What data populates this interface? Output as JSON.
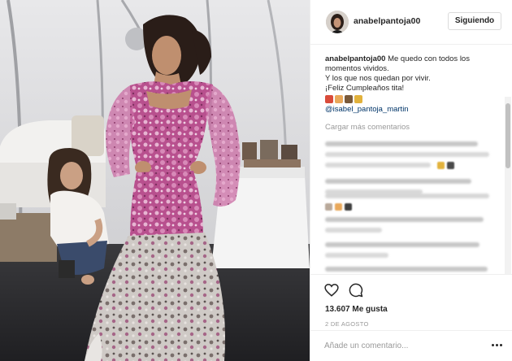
{
  "post": {
    "username": "anabelpantoja00",
    "follow_label": "Siguiendo"
  },
  "caption": {
    "username": "anabelpantoja00",
    "text_line1": " Me quedo con todos los",
    "text_line2": "momentos vividos.",
    "text_line3": "Y los que nos quedan por vivir.",
    "text_line4": "¡Feliz Cumpleaños tita!",
    "mention": "@isabel_pantoja_martin"
  },
  "comments": {
    "load_more_label": "Cargar más comentarios"
  },
  "stats": {
    "likes": "13.607 Me gusta",
    "date": "2 DE AGOSTO"
  },
  "comment_box": {
    "placeholder": "Añade un comentario..."
  },
  "icons": {
    "like": "heart-icon",
    "comment": "comment-icon",
    "more": "more-options-icon"
  },
  "colors": {
    "mention": "#003569",
    "muted_text": "#999999",
    "border": "#efefef"
  }
}
